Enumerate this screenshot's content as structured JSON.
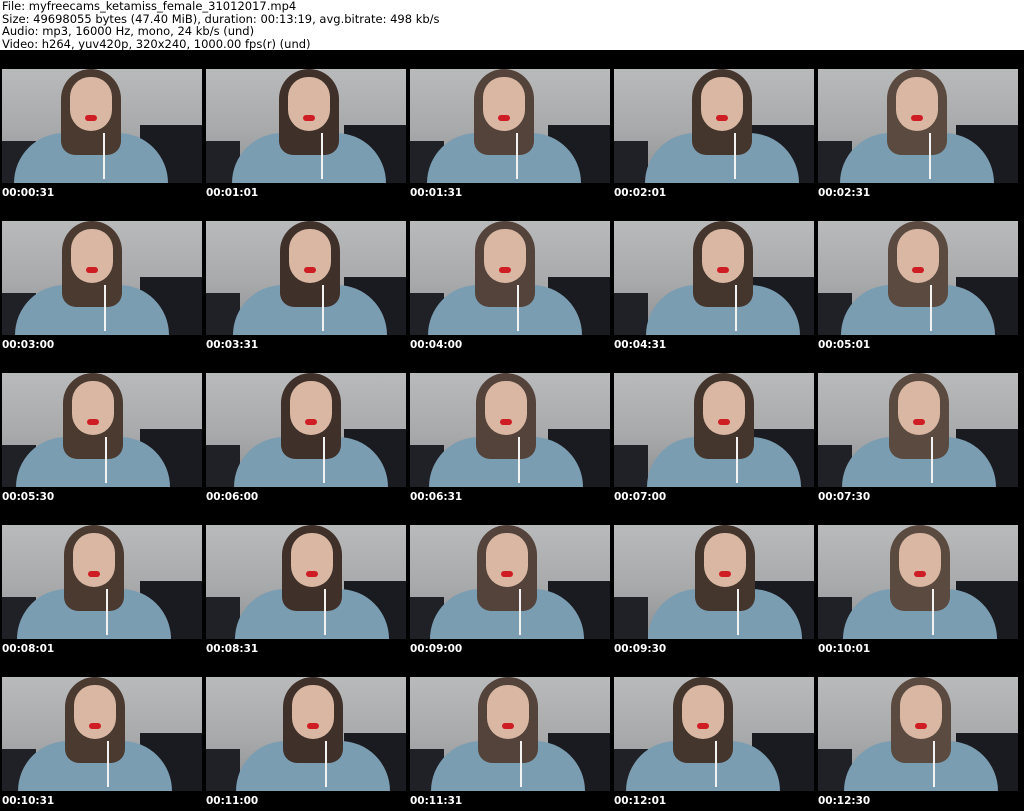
{
  "header": {
    "file_line": "File: myfreecams_ketamiss_female_31012017.mp4",
    "size_line": "Size: 49698055 bytes (47.40 MiB), duration: 00:13:19, avg.bitrate: 498 kb/s",
    "audio_line": "Audio: mp3, 16000 Hz, mono, 24 kb/s (und)",
    "video_line": "Video: h264, yuv420p, 320x240, 1000.00 fps(r) (und)"
  },
  "thumbnails": [
    {
      "timestamp": "00:00:31"
    },
    {
      "timestamp": "00:01:01"
    },
    {
      "timestamp": "00:01:31"
    },
    {
      "timestamp": "00:02:01"
    },
    {
      "timestamp": "00:02:31"
    },
    {
      "timestamp": "00:03:00"
    },
    {
      "timestamp": "00:03:31"
    },
    {
      "timestamp": "00:04:00"
    },
    {
      "timestamp": "00:04:31"
    },
    {
      "timestamp": "00:05:01"
    },
    {
      "timestamp": "00:05:30"
    },
    {
      "timestamp": "00:06:00"
    },
    {
      "timestamp": "00:06:31"
    },
    {
      "timestamp": "00:07:00"
    },
    {
      "timestamp": "00:07:30"
    },
    {
      "timestamp": "00:08:01"
    },
    {
      "timestamp": "00:08:31"
    },
    {
      "timestamp": "00:09:00"
    },
    {
      "timestamp": "00:09:30"
    },
    {
      "timestamp": "00:10:01"
    },
    {
      "timestamp": "00:10:31"
    },
    {
      "timestamp": "00:11:00"
    },
    {
      "timestamp": "00:11:31"
    },
    {
      "timestamp": "00:12:01"
    },
    {
      "timestamp": "00:12:30"
    }
  ],
  "colors": {
    "header_bg": "#ffffff",
    "grid_bg": "#000000",
    "timestamp_text": "#ffffff",
    "sweater": "#7a9db2",
    "lipstick": "#cf1d24",
    "wall": "#b0b1b2",
    "couch": "#1a1b20"
  }
}
